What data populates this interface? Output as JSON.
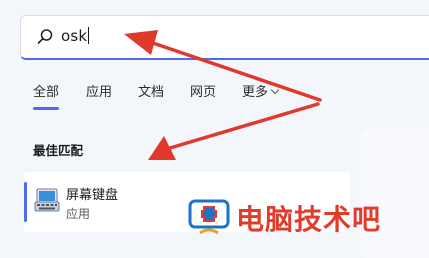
{
  "search": {
    "value": "osk",
    "icon": "search-icon"
  },
  "tabs": [
    {
      "label": "全部",
      "selected": true
    },
    {
      "label": "应用",
      "selected": false
    },
    {
      "label": "文档",
      "selected": false
    },
    {
      "label": "网页",
      "selected": false
    },
    {
      "label": "更多",
      "selected": false,
      "icon": "chevron-down-icon"
    }
  ],
  "best_match": {
    "heading": "最佳匹配",
    "result": {
      "title": "屏幕键盘",
      "type": "应用",
      "icon": "on-screen-keyboard-icon"
    }
  },
  "watermark": {
    "text": "电脑技术吧",
    "icon": "computer-doctor-logo-icon"
  },
  "colors": {
    "accent": "#4f6bed",
    "annotation_arrow": "#e0392c",
    "watermark_red": "#e23b2b",
    "watermark_blue": "#1e72c8",
    "background": "#f3f6fb"
  }
}
